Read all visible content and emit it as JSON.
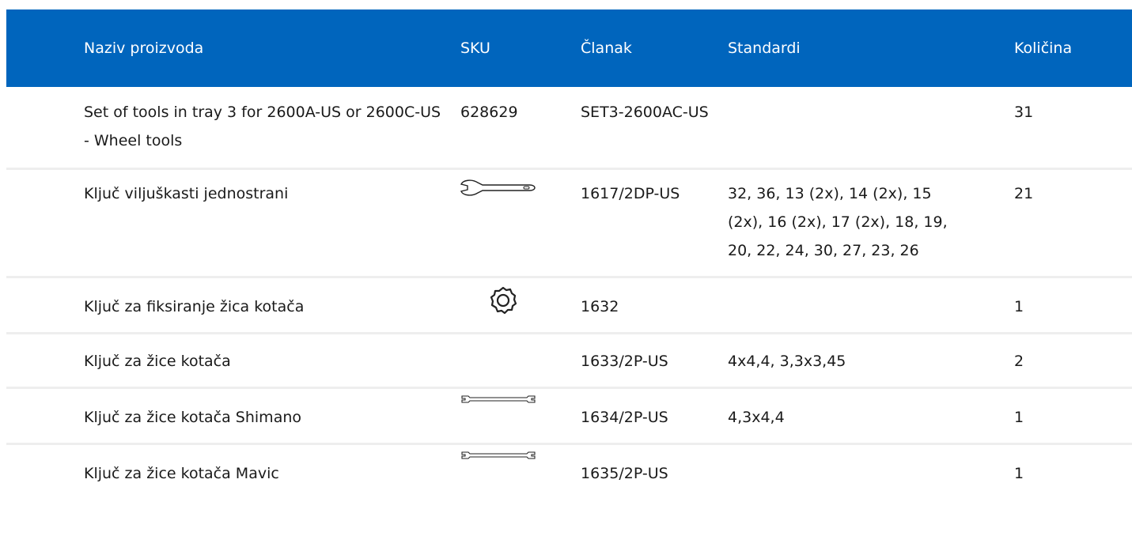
{
  "table": {
    "headers": {
      "name": "Naziv proizvoda",
      "sku": "SKU",
      "article": "Članak",
      "standards": "Standardi",
      "quantity": "Količina"
    },
    "rows": [
      {
        "name": "Set of tools in tray 3 for 2600A-US or 2600C-US - Wheel tools",
        "sku": "628629",
        "icon": "",
        "article": "SET3-2600AC-US",
        "standards": "",
        "quantity": "31"
      },
      {
        "name": "Ključ viljuškasti jednostrani",
        "sku": "",
        "icon": "open-end-wrench-icon",
        "article": "1617/2DP-US",
        "standards": "32, 36, 13 (2x), 14 (2x), 15 (2x), 16 (2x), 17 (2x), 18, 19, 20, 22, 24, 30, 27, 23, 26",
        "quantity": "21"
      },
      {
        "name": "Ključ za fiksiranje žica kotača",
        "sku": "",
        "icon": "ring-spoke-wrench-icon",
        "article": "1632",
        "standards": "",
        "quantity": "1"
      },
      {
        "name": "Ključ za žice kotača",
        "sku": "",
        "icon": "",
        "article": "1633/2P-US",
        "standards": "4x4,4, 3,3x3,45",
        "quantity": "2"
      },
      {
        "name": "Ključ za žice kotača Shimano",
        "sku": "",
        "icon": "double-spoke-wrench-icon",
        "article": "1634/2P-US",
        "standards": "4,3x4,4",
        "quantity": "1"
      },
      {
        "name": "Ključ za žice kotača Mavic",
        "sku": "",
        "icon": "double-spoke-wrench-icon",
        "article": "1635/2P-US",
        "standards": "",
        "quantity": "1"
      }
    ]
  },
  "colors": {
    "header_bg": "#0065bd",
    "header_text": "#ffffff",
    "row_divider": "#eeeeee",
    "text": "#1a1a1a"
  }
}
